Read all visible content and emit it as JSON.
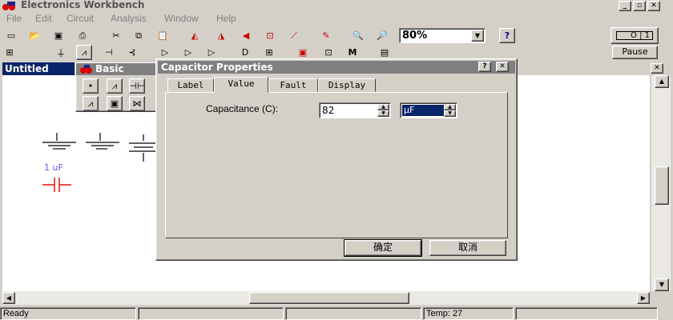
{
  "app": {
    "title": "Electronics Workbench"
  },
  "menu": [
    "File",
    "Edit",
    "Circuit",
    "Analysis",
    "Window",
    "Help"
  ],
  "menu_underline": [
    "F",
    "E",
    "C",
    "A",
    "W",
    "H"
  ],
  "toolbar": {
    "zoom_value": "80%",
    "help_label": "?",
    "pause_label": "Pause"
  },
  "document": {
    "title": "Untitled"
  },
  "palette": {
    "title": "Basic"
  },
  "canvas": {
    "capacitor_label": "1 uF"
  },
  "dialog": {
    "title": "Capacitor Properties",
    "tabs": [
      "Label",
      "Value",
      "Fault",
      "Display"
    ],
    "active_tab": "Value",
    "capacitance_label": "Capacitance (C):",
    "capacitance_value": "82",
    "unit_value": "µF",
    "ok_label": "确定",
    "cancel_label": "取消"
  },
  "status": {
    "ready": "Ready",
    "temp": "Temp:  27"
  },
  "colors": {
    "selection": "#0a246a",
    "face": "#d4d0c8",
    "label_blue": "#5a5aff",
    "capacitor_red": "#e00000"
  }
}
